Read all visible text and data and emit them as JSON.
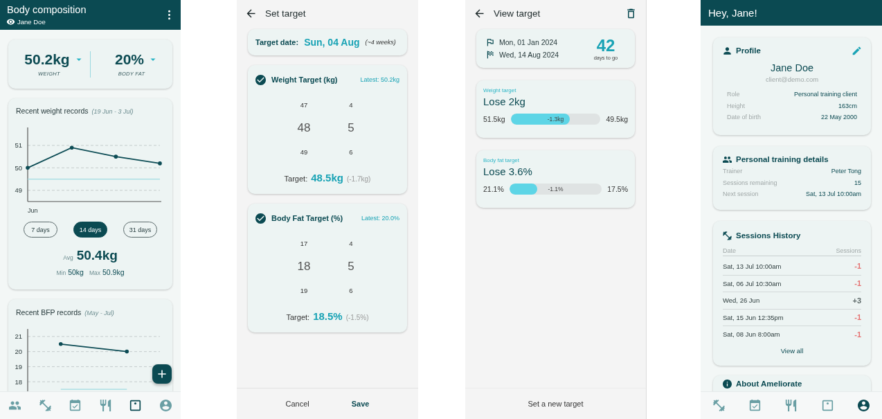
{
  "body_composition": {
    "title": "Body composition",
    "user": "Jane Doe",
    "summary": [
      {
        "value": "50.2kg",
        "label": "WEIGHT"
      },
      {
        "value": "20%",
        "label": "BODY FAT"
      }
    ],
    "weight_records": {
      "title": "Recent weight records",
      "range": "(19 Jun - 3 Jul)",
      "chart_data": {
        "type": "line",
        "categories": [
          null,
          null,
          null,
          null
        ],
        "annotations": [
          "Jun"
        ],
        "grid": true,
        "ylim": [
          48.5,
          51.8
        ],
        "yticks": [
          49,
          50,
          51
        ],
        "series": [
          {
            "color": "#0d4c55",
            "values": [
              50,
              50.9,
              50.5,
              50.2
            ]
          },
          {
            "color": "#9fdbe2",
            "values": [
              49.5,
              49.5,
              49.5,
              49.5
            ]
          }
        ]
      },
      "periods": [
        {
          "label": "7 days",
          "selected": false
        },
        {
          "label": "14 days",
          "selected": true
        },
        {
          "label": "31 days",
          "selected": false
        }
      ],
      "average": {
        "label": "Avg",
        "value": "50.4kg"
      },
      "minimum": {
        "label": "Min",
        "value": "50kg"
      },
      "maximum": {
        "label": "Max",
        "value": "50.9kg"
      }
    },
    "bfp_records": {
      "title": "Recent BFP records",
      "range": "(May - Jul)",
      "chart_data": {
        "type": "line",
        "categories": [
          null,
          null
        ],
        "grid": true,
        "ylim": [
          17,
          21.5
        ],
        "yticks": [
          18,
          19,
          20,
          21
        ],
        "series": [
          {
            "color": "#0d4c55",
            "values": [
              20.5,
              20.0
            ]
          },
          {
            "color": "#9fdbe2",
            "values": [
              17.5,
              17.5
            ]
          }
        ]
      }
    },
    "nav": [
      {
        "kind": "people",
        "selected": false
      },
      {
        "kind": "dumbbell",
        "selected": false
      },
      {
        "kind": "calendar",
        "selected": false
      },
      {
        "kind": "cutlery",
        "selected": false
      },
      {
        "kind": "scale",
        "selected": true
      },
      {
        "kind": "account",
        "selected": false
      }
    ]
  },
  "set_target": {
    "title": "Set target",
    "date_label": "Target date:",
    "date": "Sun, 04 Aug",
    "date_note": "(~4 weeks)",
    "targets": [
      {
        "title": "Weight Target (kg)",
        "checked": true,
        "latest": "Latest: 50.2kg",
        "wheels": [
          [
            {
              "label": "47",
              "selected": false
            },
            {
              "label": "48",
              "selected": true
            },
            {
              "label": "49",
              "selected": false
            }
          ],
          [
            {
              "label": "4",
              "selected": false
            },
            {
              "label": "5",
              "selected": true
            },
            {
              "label": "6",
              "selected": false
            }
          ]
        ],
        "target_label": "Target:",
        "target": "48.5kg",
        "change": "(-1.7kg)"
      },
      {
        "title": "Body Fat Target (%)",
        "checked": true,
        "latest": "Latest: 20.0%",
        "wheels": [
          [
            {
              "label": "17",
              "selected": false
            },
            {
              "label": "18",
              "selected": true
            },
            {
              "label": "19",
              "selected": false
            }
          ],
          [
            {
              "label": "4",
              "selected": false
            },
            {
              "label": "5",
              "selected": true
            },
            {
              "label": "6",
              "selected": false
            }
          ]
        ],
        "target_label": "Target:",
        "target": "18.5%",
        "change": "(-1.5%)"
      }
    ],
    "actions": [
      {
        "label": "Cancel",
        "primary": false
      },
      {
        "label": "Save",
        "primary": true
      }
    ]
  },
  "view_target": {
    "title": "View target",
    "start_date": "Mon, 01 Jan 2024",
    "end_date": "Wed, 14 Aug 2024",
    "days": "42",
    "days_label": "days to go",
    "targets": [
      {
        "label": "Weight target",
        "goal": "Lose 2kg",
        "start": "51.5kg",
        "end": "49.5kg",
        "level": 0.66,
        "change": "-1.3kg"
      },
      {
        "label": "Body fat target",
        "goal": "Lose 3.6%",
        "start": "21.1%",
        "end": "17.5%",
        "level": 0.3,
        "change": "-1.1%"
      }
    ],
    "action": "Set a new target"
  },
  "profile": {
    "greeting": "Hey, Jane!",
    "profile_card": {
      "title": "Profile",
      "name": "Jane Doe",
      "email": "client@demo.com",
      "rows": [
        {
          "label": "Role",
          "value": "Personal training client"
        },
        {
          "label": "Height",
          "value": "163cm"
        },
        {
          "label": "Date of birth",
          "value": "22 May 2000"
        }
      ]
    },
    "training_card": {
      "title": "Personal training details",
      "rows": [
        {
          "label": "Trainer",
          "value": "Peter Tong"
        },
        {
          "label": "Sessions remaining",
          "value": "15"
        },
        {
          "label": "Next session",
          "value": "Sat, 13 Jul 10:00am"
        }
      ]
    },
    "sessions_card": {
      "title": "Sessions History",
      "columns": [
        "Date",
        "Sessions"
      ],
      "rows": [
        {
          "date": "Sat, 13 Jul 10:00am",
          "change": "-1",
          "color": "#e57373"
        },
        {
          "date": "Sat, 06 Jul 10:30am",
          "change": "-1",
          "color": "#e57373"
        },
        {
          "date": "Wed, 26 Jun",
          "change": "+3",
          "color": "#5f6b6b"
        },
        {
          "date": "Sat, 15 Jun 12:35pm",
          "change": "-1",
          "color": "#e57373"
        },
        {
          "date": "Sat, 08 Jun 8:00am",
          "change": "-1",
          "color": "#e57373"
        }
      ],
      "link": "View all"
    },
    "about_card": {
      "title": "About Ameliorate"
    },
    "nav": [
      {
        "kind": "dumbbell",
        "selected": false
      },
      {
        "kind": "calendar",
        "selected": false
      },
      {
        "kind": "cutlery",
        "selected": false
      },
      {
        "kind": "scale",
        "selected": false
      },
      {
        "kind": "account",
        "selected": true
      }
    ]
  }
}
